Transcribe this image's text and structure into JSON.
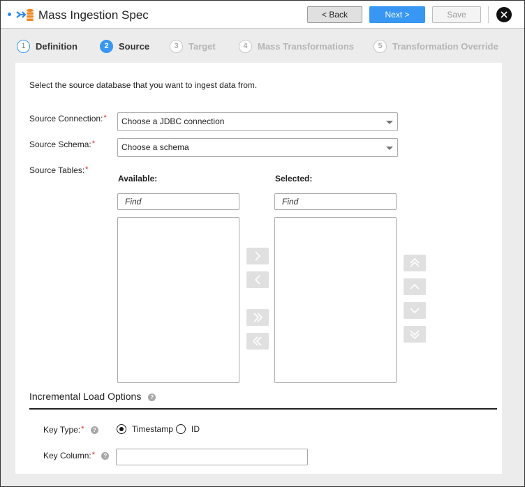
{
  "window": {
    "title": "Mass Ingestion Spec",
    "buttons": {
      "back": "< Back",
      "next": "Next >",
      "save": "Save"
    },
    "close_icon": "close-icon",
    "accent_color": "#3797f2"
  },
  "steps": [
    {
      "number": "1",
      "label": "Definition",
      "state": "done"
    },
    {
      "number": "2",
      "label": "Source",
      "state": "active"
    },
    {
      "number": "3",
      "label": "Target",
      "state": "disabled"
    },
    {
      "number": "4",
      "label": "Mass Transformations",
      "state": "disabled"
    },
    {
      "number": "5",
      "label": "Transformation Override",
      "state": "disabled"
    }
  ],
  "form": {
    "intro": "Select the source database that you want to ingest data from.",
    "source_connection": {
      "label": "Source Connection:",
      "required": "*",
      "value": "Choose a JDBC connection"
    },
    "source_schema": {
      "label": "Source Schema:",
      "required": "*",
      "value": "Choose a schema"
    },
    "source_tables": {
      "label": "Source Tables:",
      "required": "*",
      "available": {
        "heading": "Available:",
        "find_placeholder": "Find",
        "items": []
      },
      "selected": {
        "heading": "Selected:",
        "find_placeholder": "Find",
        "items": []
      },
      "transfer_buttons": [
        "move-right",
        "move-left",
        "move-all-right",
        "move-all-left"
      ],
      "order_buttons": [
        "move-to-top",
        "move-up",
        "move-down",
        "move-to-bottom"
      ]
    },
    "incremental": {
      "heading": "Incremental Load Options",
      "help": "?",
      "key_type": {
        "label": "Key Type:",
        "required": "*",
        "options": [
          "Timestamp",
          "ID"
        ],
        "selected": "Timestamp"
      },
      "key_column": {
        "label": "Key Column:",
        "required": "*",
        "value": ""
      }
    }
  }
}
